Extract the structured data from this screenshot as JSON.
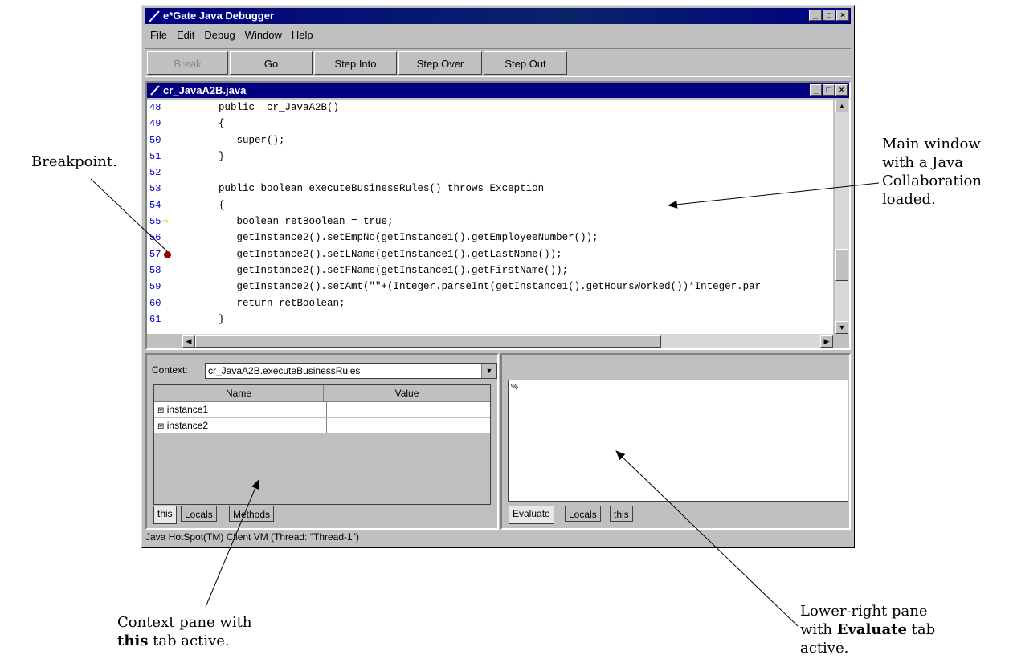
{
  "window": {
    "title": "e*Gate Java Debugger",
    "controls": [
      "_",
      "□",
      "×"
    ]
  },
  "menu": [
    "File",
    "Edit",
    "Debug",
    "Window",
    "Help"
  ],
  "toolbar": {
    "break": "Break",
    "go": "Go",
    "step_into": "Step Into",
    "step_over": "Step Over",
    "step_out": "Step Out"
  },
  "editor": {
    "title": "cr_JavaA2B.java",
    "line_numbers": [
      "48",
      "49",
      "50",
      "51",
      "52",
      "53",
      "54",
      "55",
      "56",
      "57",
      "58",
      "59",
      "60",
      "61"
    ],
    "lines": [
      "      public  cr_JavaA2B()",
      "      {",
      "         super();",
      "      }",
      "",
      "      public boolean executeBusinessRules() throws Exception",
      "      {",
      "         boolean retBoolean = true;",
      "         getInstance2().setEmpNo(getInstance1().getEmployeeNumber());",
      "         getInstance2().setLName(getInstance1().getLastName());",
      "         getInstance2().setFName(getInstance1().getFirstName());",
      "         getInstance2().setAmt(\"\"+(Integer.parseInt(getInstance1().getHoursWorked())*Integer.par",
      "         return retBoolean;",
      "      }"
    ]
  },
  "context_pane": {
    "label": "Context:",
    "value": "cr_JavaA2B.executeBusinessRules",
    "columns": [
      "Name",
      "Value"
    ],
    "rows": [
      {
        "name": "instance1",
        "value": ""
      },
      {
        "name": "instance2",
        "value": ""
      }
    ],
    "tabs": [
      "this",
      "Locals",
      "Methods"
    ]
  },
  "evaluate_pane": {
    "prompt": "%",
    "tabs": [
      "Evaluate",
      "Locals",
      "this"
    ]
  },
  "statusbar": "Java HotSpot(TM) Client VM (Thread: \"Thread-1\")",
  "callouts": {
    "breakpoint": "Breakpoint.",
    "main_window": [
      "Main window",
      "with a Java",
      "Collaboration",
      "loaded."
    ],
    "context_pane": [
      "Context pane with",
      "this",
      " tab active."
    ],
    "lower_right": [
      "Lower-right pane",
      "with ",
      "Evaluate",
      " tab",
      "active."
    ]
  }
}
